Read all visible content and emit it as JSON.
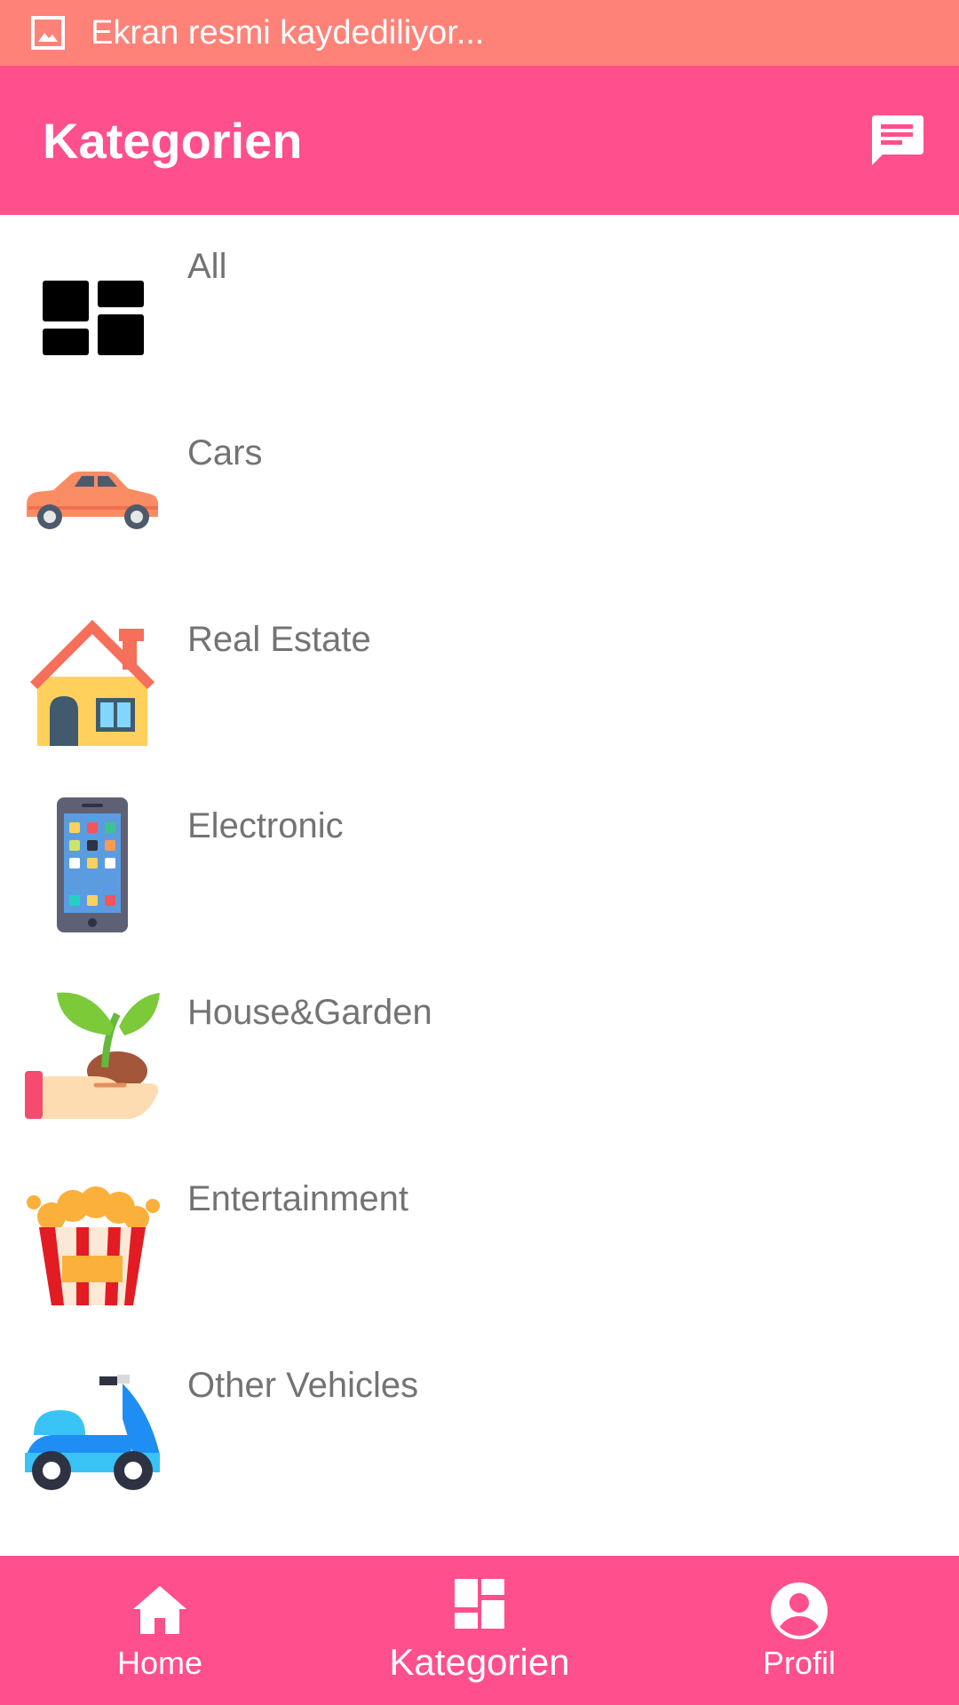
{
  "status_bar": {
    "text": "Ekran resmi kaydediliyor..."
  },
  "app_bar": {
    "title": "Kategorien",
    "action_icon": "chat-icon"
  },
  "categories": [
    {
      "label": "All",
      "icon": "grid-icon"
    },
    {
      "label": "Cars",
      "icon": "car-icon"
    },
    {
      "label": "Real Estate",
      "icon": "house-icon"
    },
    {
      "label": "Electronic",
      "icon": "smartphone-icon"
    },
    {
      "label": "House&Garden",
      "icon": "plant-icon"
    },
    {
      "label": "Entertainment",
      "icon": "popcorn-icon"
    },
    {
      "label": "Other Vehicles",
      "icon": "scooter-icon"
    }
  ],
  "bottom_nav": {
    "items": [
      {
        "label": "Home",
        "icon": "home-icon",
        "selected": false
      },
      {
        "label": "Kategorien",
        "icon": "dashboard-icon",
        "selected": true
      },
      {
        "label": "Profil",
        "icon": "account-circle-icon",
        "selected": false
      }
    ]
  },
  "colors": {
    "primary": "#ff4f8c",
    "status_bar": "#ff8279",
    "label_text": "#737373"
  }
}
